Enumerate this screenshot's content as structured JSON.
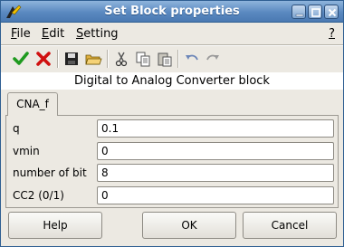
{
  "window": {
    "title": "Set Block properties",
    "controls": {
      "help": "?",
      "minimize": "minimize-icon",
      "maximize": "maximize-icon",
      "close": "close-icon"
    }
  },
  "menu": {
    "file": {
      "mnemonic": "F",
      "rest": "ile"
    },
    "edit": {
      "mnemonic": "E",
      "rest": "dit"
    },
    "setting": {
      "mnemonic": "S",
      "rest": "etting"
    },
    "help": "?"
  },
  "toolbar": {
    "icons": [
      "ok-check-icon",
      "cancel-x-icon",
      "save-icon",
      "open-folder-icon",
      "cut-icon",
      "copy-icon",
      "paste-icon",
      "undo-icon",
      "redo-icon"
    ]
  },
  "heading": "Digital to Analog Converter block",
  "tab": {
    "label": "CNA_f"
  },
  "fields": [
    {
      "label": "q",
      "value": "0.1"
    },
    {
      "label": "vmin",
      "value": "0"
    },
    {
      "label": "number of bit",
      "value": "8"
    },
    {
      "label": "CC2 (0/1)",
      "value": "0"
    }
  ],
  "buttons": {
    "help": "Help",
    "ok": "OK",
    "cancel": "Cancel"
  },
  "colors": {
    "titlebar": "#5a89c0",
    "check": "#1f9a1f",
    "cross": "#d01010"
  }
}
